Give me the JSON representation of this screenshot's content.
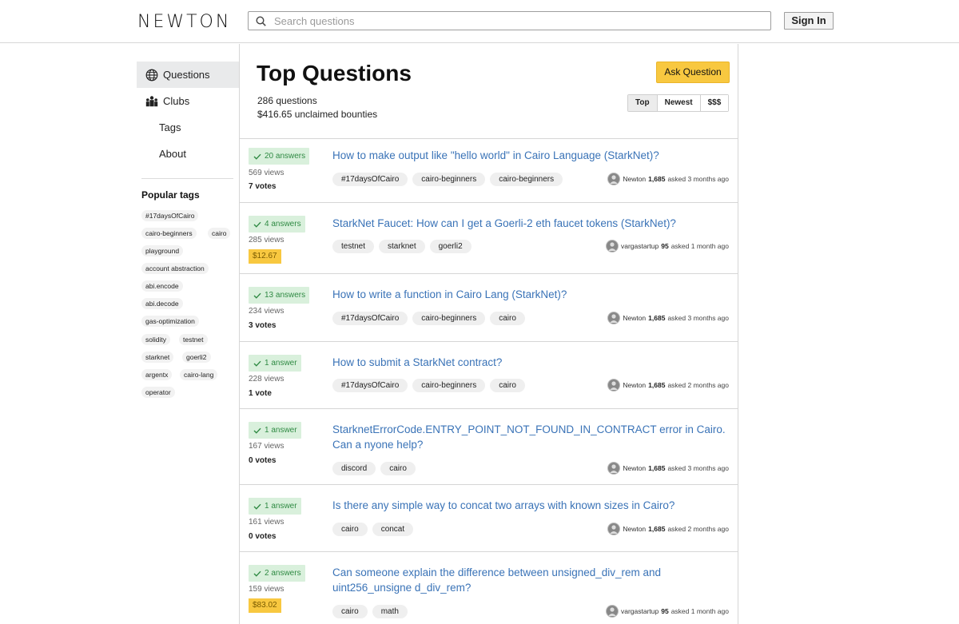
{
  "header": {
    "logo": "NEWTON",
    "search_placeholder": "Search questions",
    "signin_label": "Sign In"
  },
  "sidebar": {
    "nav": [
      {
        "label": "Questions",
        "icon": "globe-icon"
      },
      {
        "label": "Clubs",
        "icon": "clubs-icon"
      },
      {
        "label": "Tags"
      },
      {
        "label": "About"
      }
    ],
    "popular_title": "Popular tags",
    "tags": [
      "#17daysOfCairo",
      "cairo-beginners",
      "cairo",
      "playground",
      "account abstraction",
      "abi.encode",
      "abi.decode",
      "gas-optimization",
      "solidity",
      "testnet",
      "starknet",
      "goerli2",
      "argentx",
      "cairo-lang",
      "operator"
    ]
  },
  "main": {
    "title": "Top Questions",
    "ask_label": "Ask Question",
    "question_count": "286 questions",
    "bounties": "$416.65 unclaimed bounties",
    "sort_options": [
      "Top",
      "Newest",
      "$$$"
    ],
    "active_sort": "Top"
  },
  "questions": [
    {
      "answers": "20 answers",
      "views": "569 views",
      "votes": "7 votes",
      "bounty": "",
      "title": "How to make output like \"hello world\" in Cairo Language (StarkNet)?",
      "tags": [
        "#17daysOfCairo",
        "cairo-beginners",
        "cairo-beginners"
      ],
      "author": "Newton",
      "rep": "1,685",
      "asked": "asked 3 months ago"
    },
    {
      "answers": "4 answers",
      "views": "285 views",
      "votes": "",
      "bounty": "$12.67",
      "title": "StarkNet Faucet: How can I get a Goerli-2 eth faucet tokens (StarkNet)?",
      "tags": [
        "testnet",
        "starknet",
        "goerli2"
      ],
      "author": "vargastartup",
      "rep": "95",
      "asked": "asked 1 month ago"
    },
    {
      "answers": "13 answers",
      "views": "234 views",
      "votes": "3 votes",
      "bounty": "",
      "title": "How to write a function in Cairo Lang (StarkNet)?",
      "tags": [
        "#17daysOfCairo",
        "cairo-beginners",
        "cairo"
      ],
      "author": "Newton",
      "rep": "1,685",
      "asked": "asked 3 months ago"
    },
    {
      "answers": "1 answer",
      "views": "228 views",
      "votes": "1 vote",
      "bounty": "",
      "title": "How to submit a StarkNet contract?",
      "tags": [
        "#17daysOfCairo",
        "cairo-beginners",
        "cairo"
      ],
      "author": "Newton",
      "rep": "1,685",
      "asked": "asked 2 months ago"
    },
    {
      "answers": "1 answer",
      "views": "167 views",
      "votes": "0 votes",
      "bounty": "",
      "title": "StarknetErrorCode.ENTRY_POINT_NOT_FOUND_IN_CONTRACT error in Cairo. Can a nyone help?",
      "tags": [
        "discord",
        "cairo"
      ],
      "author": "Newton",
      "rep": "1,685",
      "asked": "asked 3 months ago"
    },
    {
      "answers": "1 answer",
      "views": "161 views",
      "votes": "0 votes",
      "bounty": "",
      "title": "Is there any simple way to concat two arrays with known sizes in Cairo?",
      "tags": [
        "cairo",
        "concat"
      ],
      "author": "Newton",
      "rep": "1,685",
      "asked": "asked 2 months ago"
    },
    {
      "answers": "2 answers",
      "views": "159 views",
      "votes": "",
      "bounty": "$83.02",
      "title": "Can someone explain the difference between unsigned_div_rem and uint256_unsigne d_div_rem?",
      "tags": [
        "cairo",
        "math"
      ],
      "author": "vargastartup",
      "rep": "95",
      "asked": "asked 1 month ago"
    }
  ],
  "colors": {
    "accent": "#f8c840",
    "link": "#3a73b7",
    "answered_bg": "#d9f0dc",
    "answered_text": "#2f8a43"
  }
}
